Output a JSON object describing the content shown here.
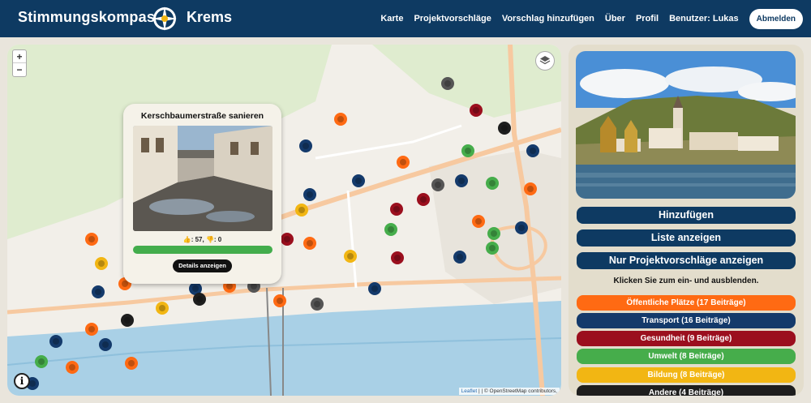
{
  "header": {
    "brand_left": "Stimmungskompass",
    "brand_right": "Krems",
    "nav": [
      "Karte",
      "Projektvorschläge",
      "Vorschlag hinzufügen",
      "Über",
      "Profil",
      "Benutzer: Lukas"
    ],
    "logout_label": "Abmelden"
  },
  "map": {
    "zoom_in": "+",
    "zoom_out": "−",
    "info_label": "i",
    "attribution_leaflet": "Leaflet",
    "attribution_rest": " | | © OpenStreetMap contributors,"
  },
  "popup": {
    "title": "Kerschbaumerstraße sanieren",
    "votes": "👍: 57, 👎: 0",
    "details_label": "Details anzeigen",
    "approval_fraction": 1.0
  },
  "panel": {
    "add_label": "Hinzufügen",
    "list_label": "Liste anzeigen",
    "only_projects_label": "Nur Projektvorschläge anzeigen",
    "hint": "Klicken Sie zum ein- und ausblenden.",
    "categories": [
      {
        "label": "Öffentliche Plätze (17 Beiträge)",
        "color": "#ff6a13"
      },
      {
        "label": "Transport (16 Beiträge)",
        "color": "#143a6b"
      },
      {
        "label": "Gesundheit (9 Beiträge)",
        "color": "#9b0f1e"
      },
      {
        "label": "Umwelt (8 Beiträge)",
        "color": "#46ad4b"
      },
      {
        "label": "Bildung (8 Beiträge)",
        "color": "#f2b613"
      },
      {
        "label": "Andere (4 Beiträge)",
        "color": "#1e1e1e"
      }
    ]
  }
}
